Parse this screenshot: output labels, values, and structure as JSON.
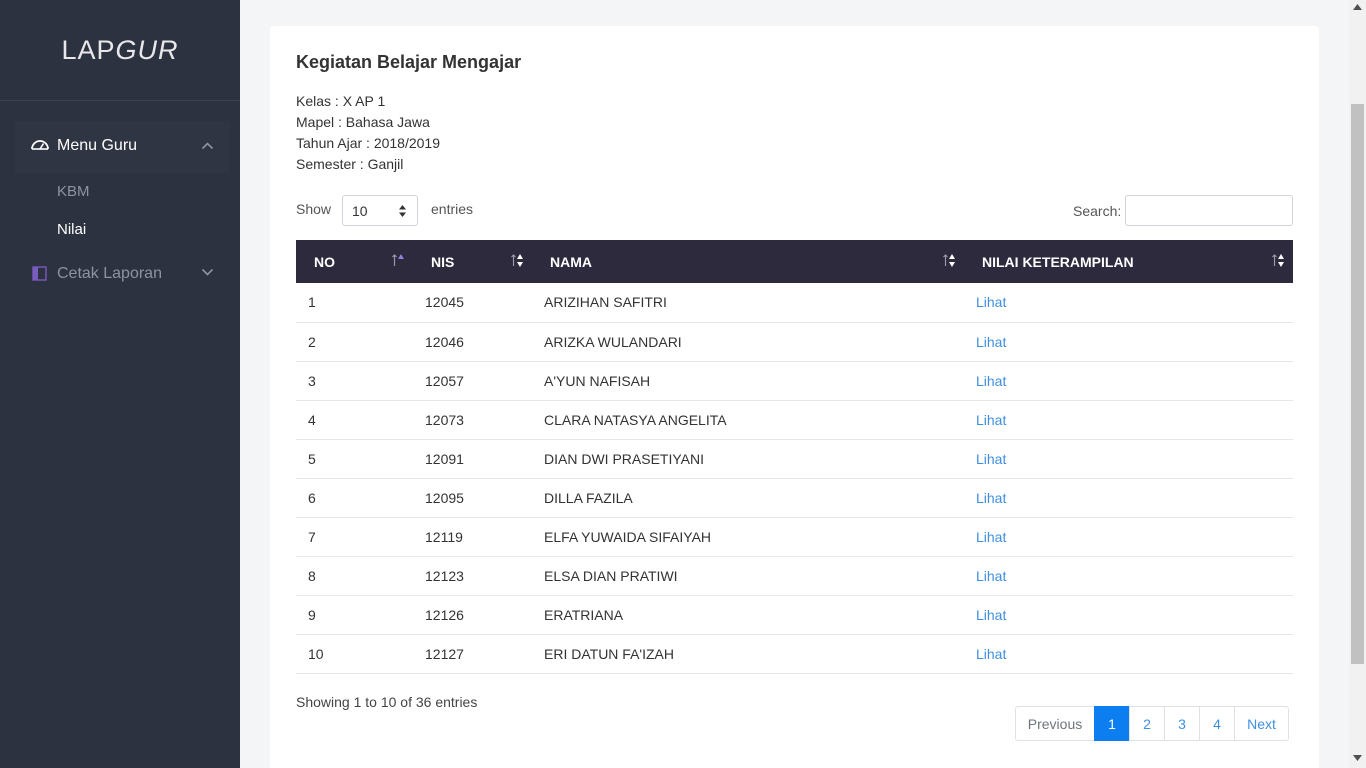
{
  "brand": {
    "part1": "LAP",
    "part2": "GUR"
  },
  "sidebar": {
    "menu_guru": {
      "label": "Menu Guru",
      "icon": "dashboard-icon"
    },
    "sub_items": [
      {
        "label": "KBM"
      },
      {
        "label": "Nilai",
        "active": true
      }
    ],
    "cetak_laporan": {
      "label": "Cetak Laporan",
      "icon": "book-icon"
    }
  },
  "card": {
    "title": "Kegiatan Belajar Mengajar",
    "info": [
      "Kelas : X AP 1",
      "Mapel : Bahasa Jawa",
      "Tahun Ajar : 2018/2019",
      "Semester : Ganjil"
    ]
  },
  "controls": {
    "show_label": "Show",
    "show_value": "10",
    "entries_label": "entries",
    "search_label": "Search:",
    "search_value": ""
  },
  "table": {
    "headers": [
      "NO",
      "NIS",
      "NAMA",
      "NILAI KETERAMPILAN"
    ],
    "rows": [
      [
        "1",
        "12045",
        "ARIZIHAN SAFITRI",
        "Lihat"
      ],
      [
        "2",
        "12046",
        "ARIZKA WULANDARI",
        "Lihat"
      ],
      [
        "3",
        "12057",
        "A'YUN NAFISAH",
        "Lihat"
      ],
      [
        "4",
        "12073",
        "CLARA NATASYA ANGELITA",
        "Lihat"
      ],
      [
        "5",
        "12091",
        "DIAN DWI PRASETIYANI",
        "Lihat"
      ],
      [
        "6",
        "12095",
        "DILLA FAZILA",
        "Lihat"
      ],
      [
        "7",
        "12119",
        "ELFA YUWAIDA SIFAIYAH",
        "Lihat"
      ],
      [
        "8",
        "12123",
        "ELSA DIAN PRATIWI",
        "Lihat"
      ],
      [
        "9",
        "12126",
        "ERATRIANA",
        "Lihat"
      ],
      [
        "10",
        "12127",
        "ERI DATUN FA'IZAH",
        "Lihat"
      ]
    ]
  },
  "footer": {
    "showing": "Showing 1 to 10 of 36 entries",
    "previous": "Previous",
    "pages": [
      "1",
      "2",
      "3",
      "4"
    ],
    "next": "Next"
  },
  "colors": {
    "sidebar_bg": "#2c323f",
    "table_header_bg": "#2d2a3e",
    "link": "#3f8fe0",
    "active_page": "#0d7ef0"
  }
}
